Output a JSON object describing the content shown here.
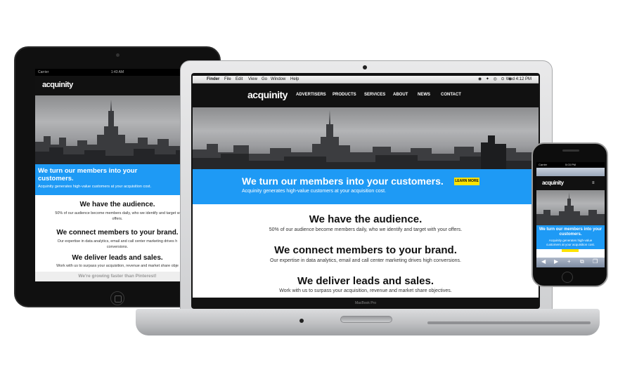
{
  "site": {
    "logo": "acquinity",
    "nav": [
      "ADVERTISERS",
      "PRODUCTS",
      "SERVICES",
      "ABOUT",
      "NEWS",
      "CONTACT"
    ],
    "hero_title": "We turn our members into your customers.",
    "hero_subtitle": "Acquinity generates high-value customers at your acquisition cost.",
    "cta": "LEARN MORE",
    "sections": [
      {
        "title": "We have the audience.",
        "text": "50% of our audience become members daily, who we identify and target with your offers."
      },
      {
        "title": "We connect members to your brand.",
        "text": "Our expertise in data analytics, email and call center marketing drives high conversions."
      },
      {
        "title": "We deliver leads and sales.",
        "text": "Work with us to surpass your acquisition, revenue and market share objectives."
      }
    ],
    "growth_banner": "We're growing faster than Pinterest!"
  },
  "tablet": {
    "carrier": "Carrier",
    "time": "1:43 AM",
    "hero_line1": "We turn our members into your",
    "hero_line2": "customers.",
    "s1_text_line1": "50% of our audience become members daily, who we identify and target w",
    "s1_text_line2": "offers.",
    "s2_text_line1": "Our expertise in data analytics, email and call center marketing drives h",
    "s2_text_line2": "conversions.",
    "s3_text": "Work with us to surpass your acquisition, revenue and market share obje"
  },
  "laptop": {
    "menubar": {
      "apple": "",
      "items": [
        "Finder",
        "File",
        "Edit",
        "View",
        "Go",
        "Window",
        "Help"
      ],
      "status_icons": "◉ ✦ ◎ ⊙ ◈",
      "clock": "Wed 4:12 PM"
    },
    "model": "MacBook Pro"
  },
  "phone": {
    "carrier": "Carrier",
    "time": "5:03 PM",
    "hero_line1": "We turn our members into your",
    "hero_line2": "customers.",
    "sub_line1": "Acquinity generates high-value",
    "sub_line2": "customers at your acquisition cost.",
    "menu_icon": "≡",
    "toolbar_icons": [
      "◀",
      "▶",
      "+",
      "⧉",
      "❐"
    ]
  },
  "colors": {
    "hero_blue": "#1e9af5",
    "cta_yellow": "#ffe300",
    "header_black": "#111111"
  }
}
